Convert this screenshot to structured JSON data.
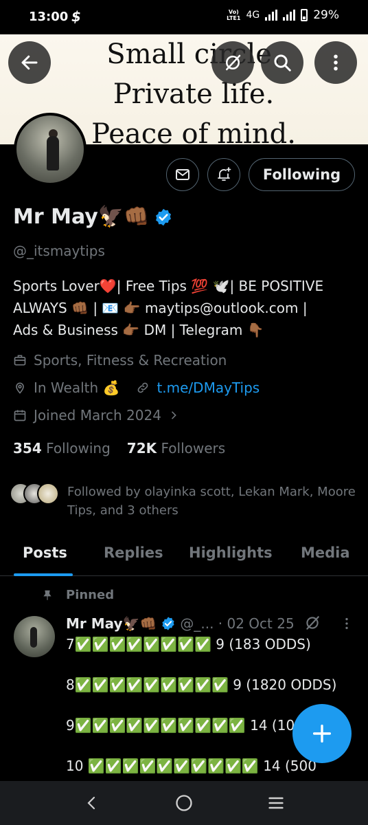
{
  "status_bar": {
    "time": "13:00",
    "network": "4G",
    "battery": "29%",
    "volte": "Vo)\nLTE1"
  },
  "banner": {
    "lines": [
      "Small circle.",
      "Private life.",
      "Peace of mind."
    ]
  },
  "actions": {
    "following_label": "Following"
  },
  "profile": {
    "name": "Mr May🦅👊🏾",
    "handle": "@_itsmaytips",
    "bio": "Sports Lover❤️| Free Tips 💯 🕊️| BE POSITIVE\nALWAYS 👊🏾 | 📧 👉🏾 maytips@outlook.com |\nAds & Business 👉🏾 DM | Telegram 👇🏾",
    "category": "Sports, Fitness & Recreation",
    "location": "In Wealth 💰",
    "link": "t.me/DMayTips",
    "joined": "Joined March 2024",
    "following_count": "354",
    "following_label": "Following",
    "followers_count": "72K",
    "followers_label": "Followers",
    "followed_by": "Followed by olayinka scott, Lekan Mark, Moore Tips, and 3 others"
  },
  "tabs": [
    {
      "label": "Posts",
      "active": true
    },
    {
      "label": "Replies",
      "active": false
    },
    {
      "label": "Highlights",
      "active": false
    },
    {
      "label": "Media",
      "active": false
    }
  ],
  "post": {
    "pinned_label": "Pinned",
    "author": "Mr May🦅👊🏾",
    "handle_date": "@_... · 02 Oct 25",
    "lines": [
      "7✅✅✅✅✅✅✅✅ 9 (183 ODDS)",
      "8✅✅✅✅✅✅✅✅✅ 9 (1820 ODDS)",
      "9✅✅✅✅✅✅✅✅✅✅ 14 (100",
      "10 ✅✅✅✅✅✅✅✅✅✅ 14 (500"
    ]
  },
  "colors": {
    "accent": "#1d9bf0",
    "muted": "#71767b",
    "background": "#000000"
  }
}
